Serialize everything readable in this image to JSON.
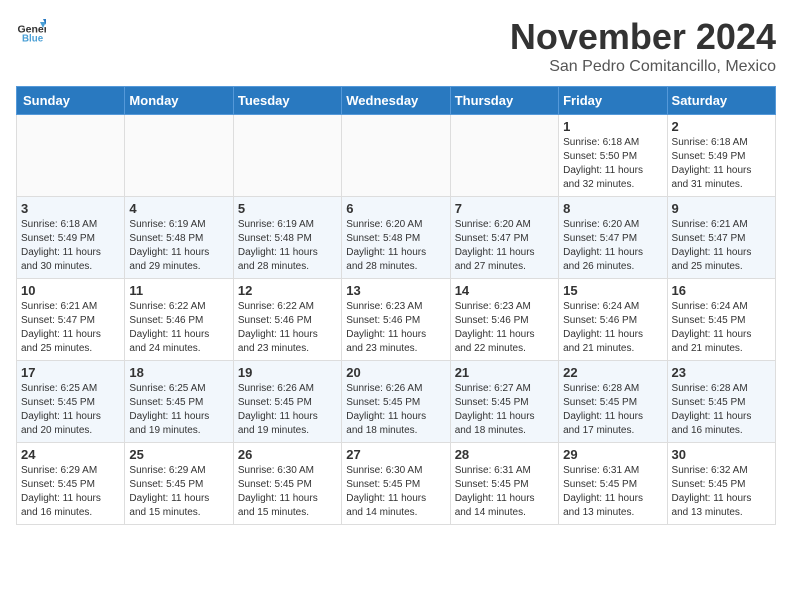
{
  "logo": {
    "line1": "General",
    "line2": "Blue"
  },
  "title": "November 2024",
  "subtitle": "San Pedro Comitancillo, Mexico",
  "days_of_week": [
    "Sunday",
    "Monday",
    "Tuesday",
    "Wednesday",
    "Thursday",
    "Friday",
    "Saturday"
  ],
  "weeks": [
    [
      {
        "day": "",
        "info": ""
      },
      {
        "day": "",
        "info": ""
      },
      {
        "day": "",
        "info": ""
      },
      {
        "day": "",
        "info": ""
      },
      {
        "day": "",
        "info": ""
      },
      {
        "day": "1",
        "info": "Sunrise: 6:18 AM\nSunset: 5:50 PM\nDaylight: 11 hours\nand 32 minutes."
      },
      {
        "day": "2",
        "info": "Sunrise: 6:18 AM\nSunset: 5:49 PM\nDaylight: 11 hours\nand 31 minutes."
      }
    ],
    [
      {
        "day": "3",
        "info": "Sunrise: 6:18 AM\nSunset: 5:49 PM\nDaylight: 11 hours\nand 30 minutes."
      },
      {
        "day": "4",
        "info": "Sunrise: 6:19 AM\nSunset: 5:48 PM\nDaylight: 11 hours\nand 29 minutes."
      },
      {
        "day": "5",
        "info": "Sunrise: 6:19 AM\nSunset: 5:48 PM\nDaylight: 11 hours\nand 28 minutes."
      },
      {
        "day": "6",
        "info": "Sunrise: 6:20 AM\nSunset: 5:48 PM\nDaylight: 11 hours\nand 28 minutes."
      },
      {
        "day": "7",
        "info": "Sunrise: 6:20 AM\nSunset: 5:47 PM\nDaylight: 11 hours\nand 27 minutes."
      },
      {
        "day": "8",
        "info": "Sunrise: 6:20 AM\nSunset: 5:47 PM\nDaylight: 11 hours\nand 26 minutes."
      },
      {
        "day": "9",
        "info": "Sunrise: 6:21 AM\nSunset: 5:47 PM\nDaylight: 11 hours\nand 25 minutes."
      }
    ],
    [
      {
        "day": "10",
        "info": "Sunrise: 6:21 AM\nSunset: 5:47 PM\nDaylight: 11 hours\nand 25 minutes."
      },
      {
        "day": "11",
        "info": "Sunrise: 6:22 AM\nSunset: 5:46 PM\nDaylight: 11 hours\nand 24 minutes."
      },
      {
        "day": "12",
        "info": "Sunrise: 6:22 AM\nSunset: 5:46 PM\nDaylight: 11 hours\nand 23 minutes."
      },
      {
        "day": "13",
        "info": "Sunrise: 6:23 AM\nSunset: 5:46 PM\nDaylight: 11 hours\nand 23 minutes."
      },
      {
        "day": "14",
        "info": "Sunrise: 6:23 AM\nSunset: 5:46 PM\nDaylight: 11 hours\nand 22 minutes."
      },
      {
        "day": "15",
        "info": "Sunrise: 6:24 AM\nSunset: 5:46 PM\nDaylight: 11 hours\nand 21 minutes."
      },
      {
        "day": "16",
        "info": "Sunrise: 6:24 AM\nSunset: 5:45 PM\nDaylight: 11 hours\nand 21 minutes."
      }
    ],
    [
      {
        "day": "17",
        "info": "Sunrise: 6:25 AM\nSunset: 5:45 PM\nDaylight: 11 hours\nand 20 minutes."
      },
      {
        "day": "18",
        "info": "Sunrise: 6:25 AM\nSunset: 5:45 PM\nDaylight: 11 hours\nand 19 minutes."
      },
      {
        "day": "19",
        "info": "Sunrise: 6:26 AM\nSunset: 5:45 PM\nDaylight: 11 hours\nand 19 minutes."
      },
      {
        "day": "20",
        "info": "Sunrise: 6:26 AM\nSunset: 5:45 PM\nDaylight: 11 hours\nand 18 minutes."
      },
      {
        "day": "21",
        "info": "Sunrise: 6:27 AM\nSunset: 5:45 PM\nDaylight: 11 hours\nand 18 minutes."
      },
      {
        "day": "22",
        "info": "Sunrise: 6:28 AM\nSunset: 5:45 PM\nDaylight: 11 hours\nand 17 minutes."
      },
      {
        "day": "23",
        "info": "Sunrise: 6:28 AM\nSunset: 5:45 PM\nDaylight: 11 hours\nand 16 minutes."
      }
    ],
    [
      {
        "day": "24",
        "info": "Sunrise: 6:29 AM\nSunset: 5:45 PM\nDaylight: 11 hours\nand 16 minutes."
      },
      {
        "day": "25",
        "info": "Sunrise: 6:29 AM\nSunset: 5:45 PM\nDaylight: 11 hours\nand 15 minutes."
      },
      {
        "day": "26",
        "info": "Sunrise: 6:30 AM\nSunset: 5:45 PM\nDaylight: 11 hours\nand 15 minutes."
      },
      {
        "day": "27",
        "info": "Sunrise: 6:30 AM\nSunset: 5:45 PM\nDaylight: 11 hours\nand 14 minutes."
      },
      {
        "day": "28",
        "info": "Sunrise: 6:31 AM\nSunset: 5:45 PM\nDaylight: 11 hours\nand 14 minutes."
      },
      {
        "day": "29",
        "info": "Sunrise: 6:31 AM\nSunset: 5:45 PM\nDaylight: 11 hours\nand 13 minutes."
      },
      {
        "day": "30",
        "info": "Sunrise: 6:32 AM\nSunset: 5:45 PM\nDaylight: 11 hours\nand 13 minutes."
      }
    ]
  ]
}
